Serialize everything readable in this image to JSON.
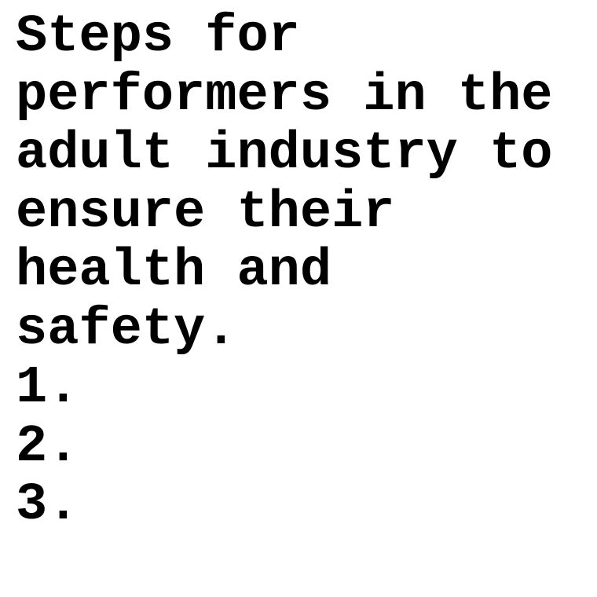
{
  "document": {
    "heading": "Steps for performers in the adult industry to ensure their health and safety.",
    "steps": [
      "1.",
      "2.",
      "3."
    ]
  }
}
